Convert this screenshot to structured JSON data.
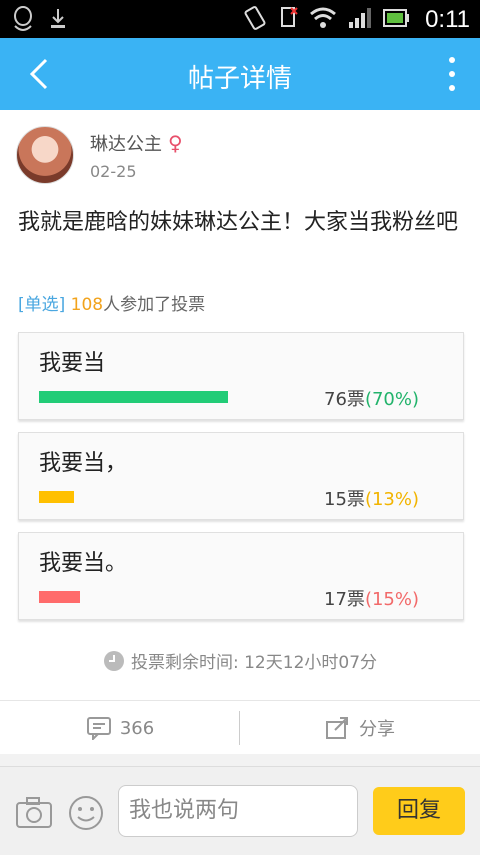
{
  "status_bar": {
    "time": "0:11"
  },
  "header": {
    "title": "帖子详情"
  },
  "post": {
    "author": "琳达公主",
    "gender_symbol": "♀",
    "date": "02-25",
    "content": "我就是鹿晗的妹妹琳达公主！大家当我粉丝吧"
  },
  "poll": {
    "type_tag": "[单选]",
    "participants": "108",
    "participants_suffix": "人参加了投票",
    "options": [
      {
        "label": "我要当",
        "votes": "76票",
        "percent": "(70%)",
        "fraction": 0.7,
        "bar_color": "#22cc77",
        "pct_color": "#22b36b"
      },
      {
        "label": "我要当，",
        "votes": "15票",
        "percent": "(13%)",
        "fraction": 0.13,
        "bar_color": "#ffc000",
        "pct_color": "#f2b400"
      },
      {
        "label": "我要当。",
        "votes": "17票",
        "percent": "(15%)",
        "fraction": 0.15,
        "bar_color": "#ff6b6b",
        "pct_color": "#f26a6a"
      }
    ],
    "remaining_label": "投票剩余时间: 12天12小时07分"
  },
  "actions": {
    "comments_count": "366",
    "share_label": "分享"
  },
  "bottom": {
    "input_placeholder": "我也说两句",
    "reply_label": "回复"
  }
}
